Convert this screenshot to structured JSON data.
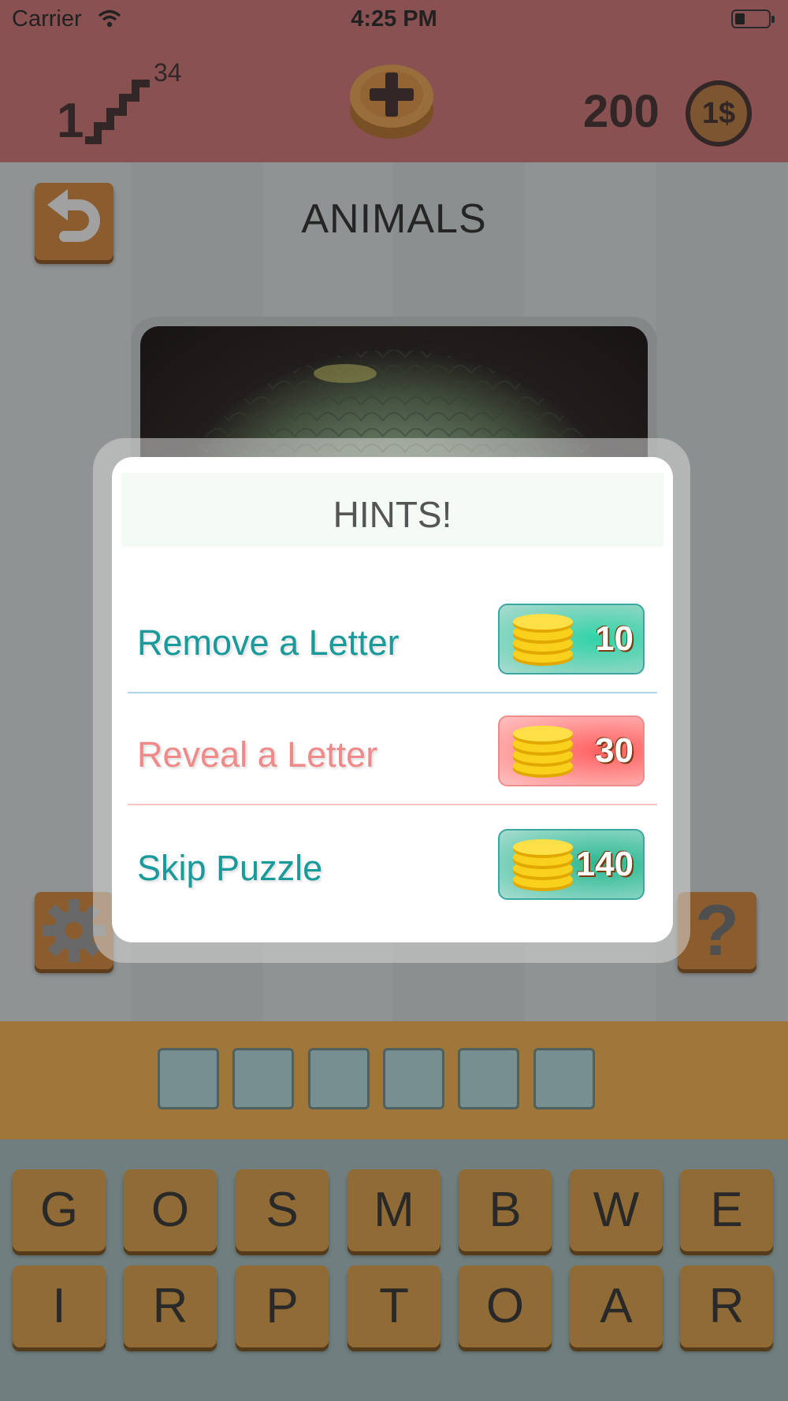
{
  "status_bar": {
    "carrier": "Carrier",
    "time": "4:25 PM"
  },
  "top_bar": {
    "level": "1",
    "level_total": "34",
    "coins": "200",
    "coin_symbol": "1$"
  },
  "category": "ANIMALS",
  "answer_slots": 6,
  "keyboard": {
    "row1": [
      "G",
      "O",
      "S",
      "M",
      "B",
      "W",
      "E"
    ],
    "row2": [
      "I",
      "R",
      "P",
      "T",
      "O",
      "A",
      "R"
    ]
  },
  "hints_dialog": {
    "title": "HINTS!",
    "options": [
      {
        "label": "Remove a Letter",
        "price": "10",
        "color": "#1a9a9a"
      },
      {
        "label": "Reveal a Letter",
        "price": "30",
        "color": "#ef8a8a"
      },
      {
        "label": "Skip Puzzle",
        "price": "140",
        "color": "#1a9a9a"
      }
    ]
  },
  "colors": {
    "top_bar": "#d57171",
    "button": "#d88530",
    "answer_strip": "#ffb447",
    "key": "#e19f3f"
  },
  "icons": [
    "wifi-icon",
    "battery-icon",
    "stairs-icon",
    "plus-coin-icon",
    "dollar-coin-icon",
    "back-arrow-icon",
    "gear-icon",
    "question-mark-icon",
    "coin-stack-icon"
  ]
}
